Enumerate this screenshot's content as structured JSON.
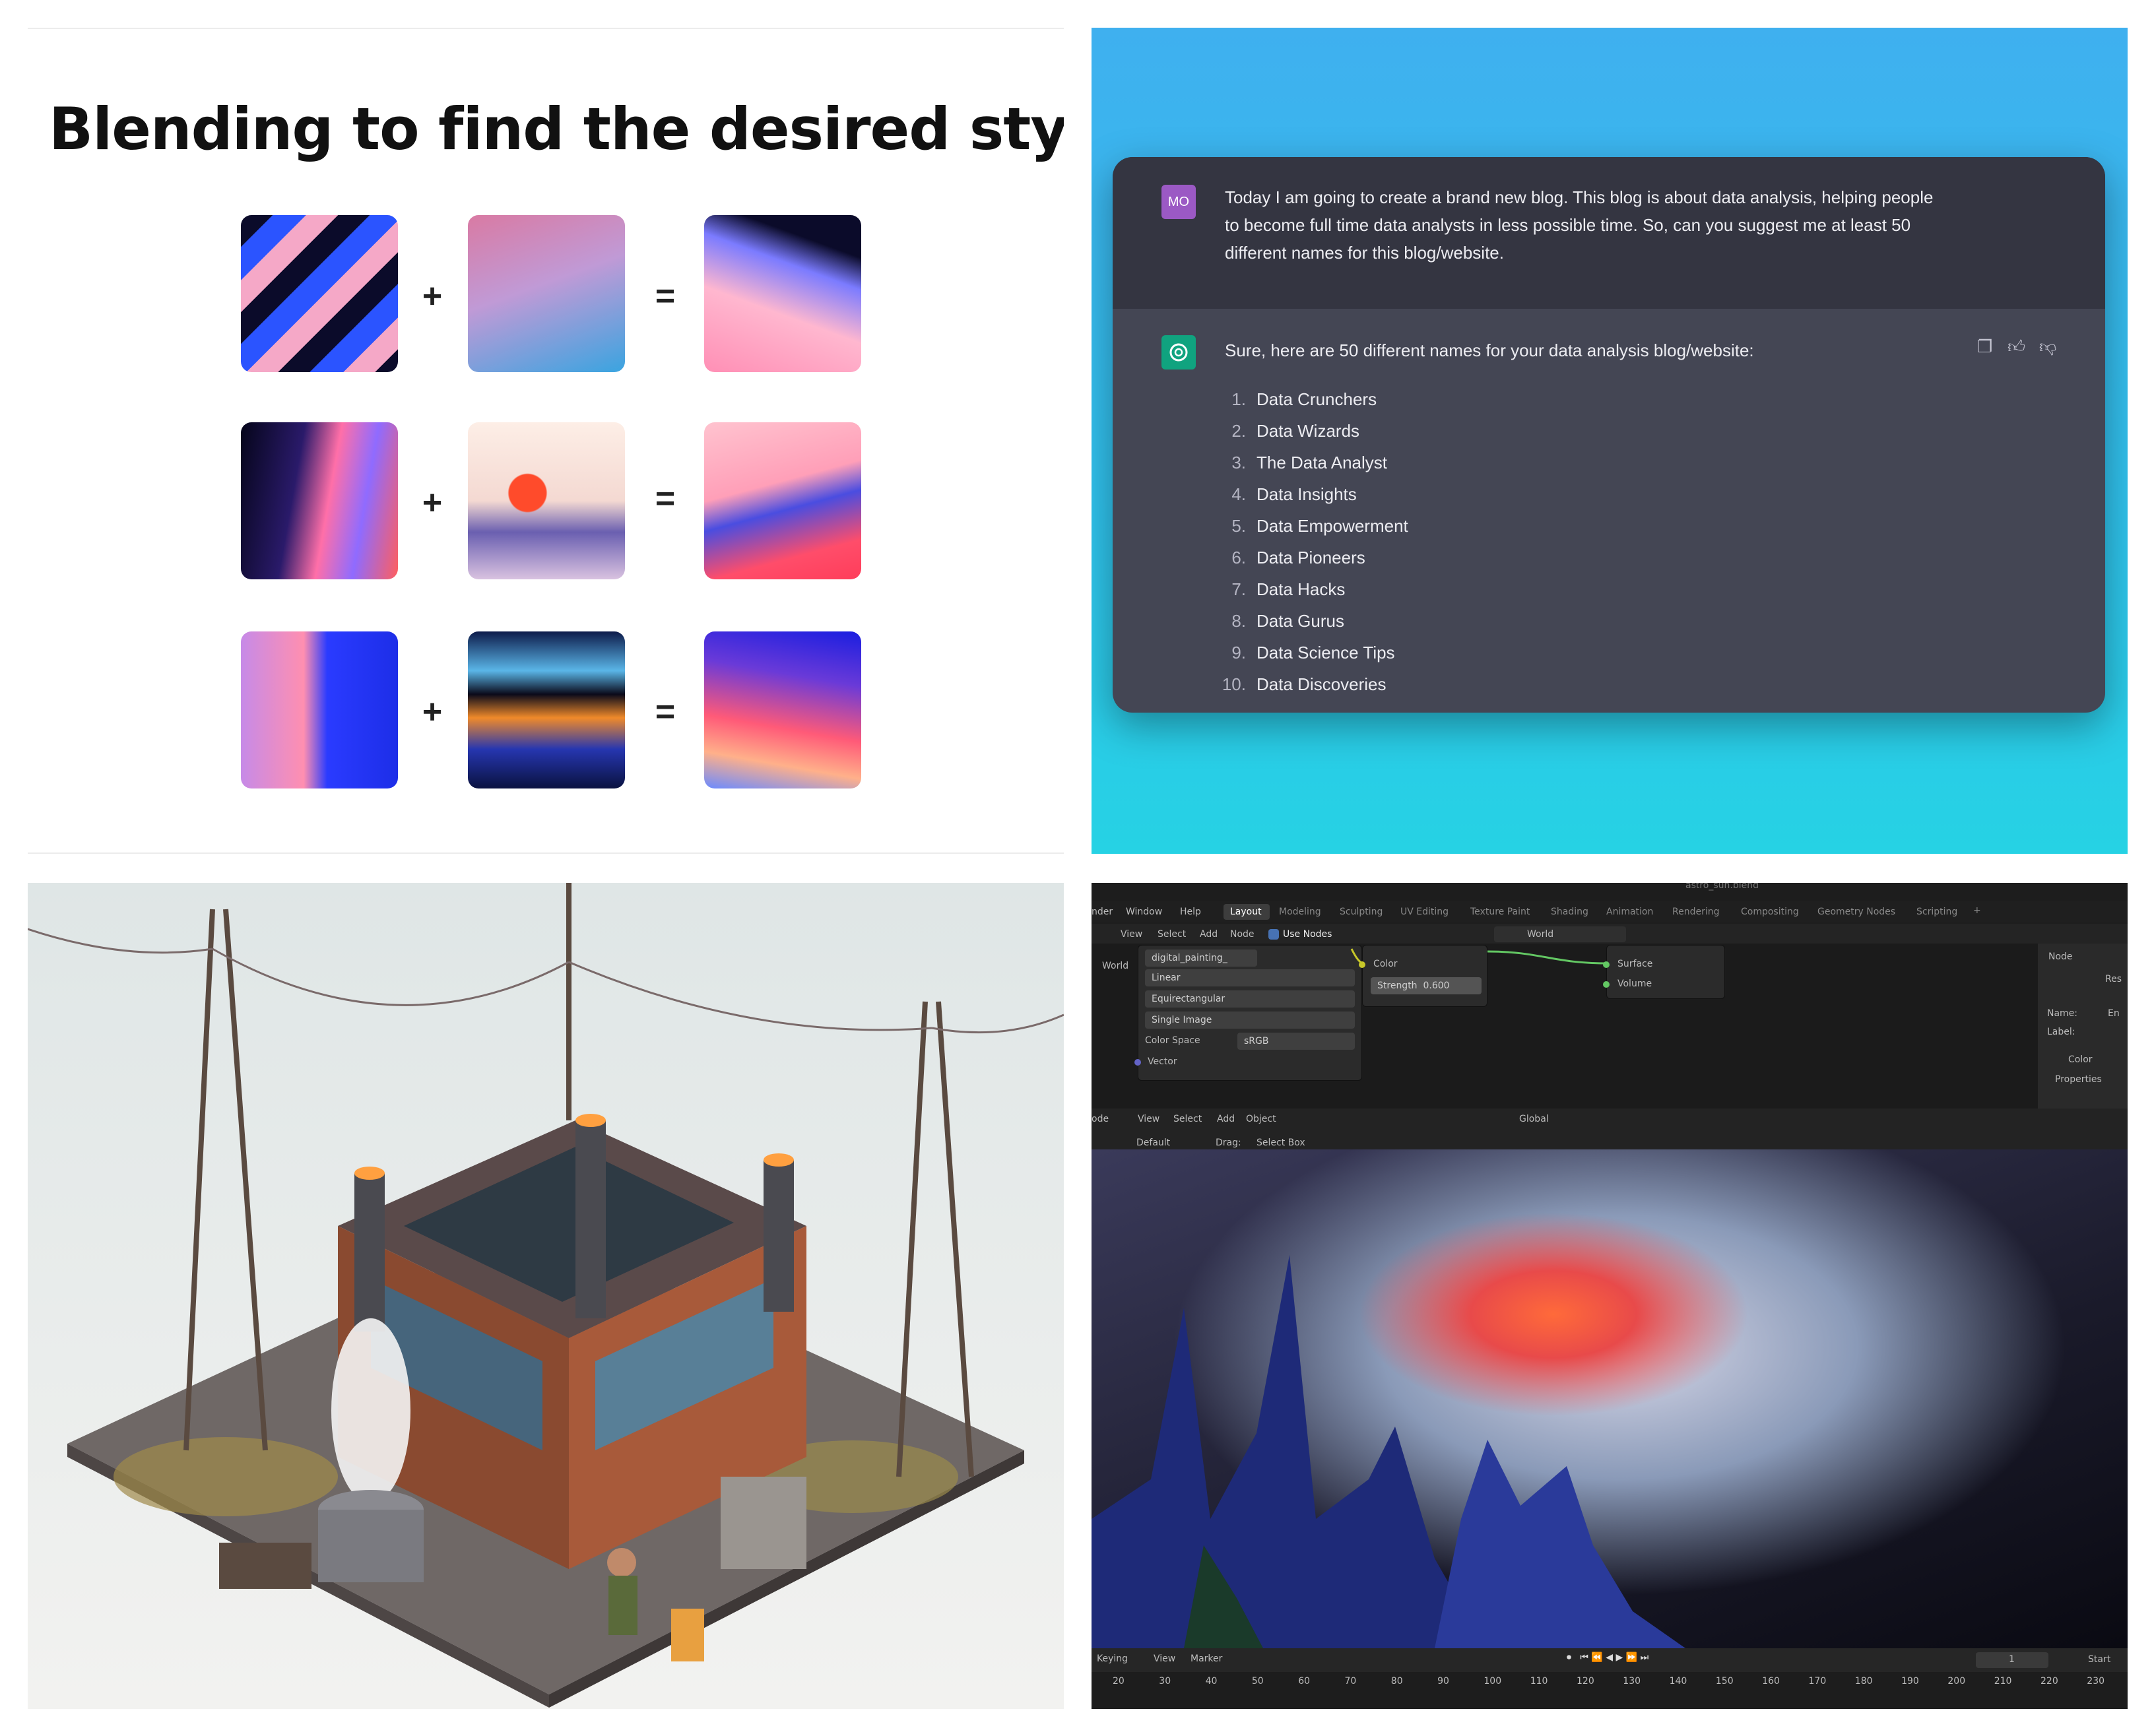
{
  "blending": {
    "headline": "Blending to find the desired style",
    "ops": {
      "plus": "+",
      "equals": "="
    }
  },
  "chat": {
    "user_avatar": "MO",
    "user_message": "Today I am going to create a brand new blog. This blog is about data analysis, helping people to become full time data analysts in less possible time. So, can you suggest me at least 50 different names for this blog/website:",
    "user_lines": [
      "Today I am going to create a brand new blog. This blog is about data analysis, helping people",
      "to become full time data analysts in less possible time. So, can you suggest me at least 50",
      "different names for this blog/website."
    ],
    "assistant_intro": "Sure, here are 50 different names for your data analysis blog/website:",
    "items": [
      {
        "n": "1.",
        "t": "Data Crunchers"
      },
      {
        "n": "2.",
        "t": "Data Wizards"
      },
      {
        "n": "3.",
        "t": "The Data Analyst"
      },
      {
        "n": "4.",
        "t": "Data Insights"
      },
      {
        "n": "5.",
        "t": "Data Empowerment"
      },
      {
        "n": "6.",
        "t": "Data Pioneers"
      },
      {
        "n": "7.",
        "t": "Data Hacks"
      },
      {
        "n": "8.",
        "t": "Data Gurus"
      },
      {
        "n": "9.",
        "t": "Data Science Tips"
      },
      {
        "n": "10.",
        "t": "Data Discoveries"
      }
    ],
    "icons": [
      "copy-icon",
      "thumbs-up-icon",
      "thumbs-down-icon"
    ]
  },
  "blender": {
    "file_title": "astro_sun.blend",
    "menu": [
      "nder",
      "Window",
      "Help"
    ],
    "workspaces": [
      "Layout",
      "Modeling",
      "Sculpting",
      "UV Editing",
      "Texture Paint",
      "Shading",
      "Animation",
      "Rendering",
      "Compositing",
      "Geometry Nodes",
      "Scripting",
      "+"
    ],
    "node_header": [
      "View",
      "Select",
      "Add",
      "Node"
    ],
    "use_nodes": "Use Nodes",
    "world_label": "World",
    "world_field": "World",
    "image_node": {
      "image_name": "digital_painting_",
      "rows": [
        "Linear",
        "Equirectangular",
        "Single Image"
      ],
      "color_space_label": "Color Space",
      "color_space_value": "sRGB",
      "vector": "Vector"
    },
    "background_node": {
      "color": "Color",
      "strength": "Strength",
      "strength_value": "0.600"
    },
    "output_node": {
      "surface": "Surface",
      "volume": "Volume"
    },
    "side_panel": {
      "tab": "Node",
      "reset": "Res",
      "name_label": "Name:",
      "name_value": "En",
      "label_label": "Label:",
      "color": "Color",
      "properties": "Properties"
    },
    "viewport_header": [
      "ode",
      "View",
      "Select",
      "Add",
      "Object"
    ],
    "transform": "Global",
    "orientation_default": "Default",
    "drag_label": "Drag:",
    "drag_value": "Select Box",
    "timeline_menu": [
      "Keying",
      "View",
      "Marker"
    ],
    "frame_current": "1",
    "start_label": "Start",
    "frame_ticks": [
      "20",
      "30",
      "40",
      "50",
      "60",
      "70",
      "80",
      "90",
      "100",
      "110",
      "120",
      "130",
      "140",
      "150",
      "160",
      "170",
      "180",
      "190",
      "200",
      "210",
      "220",
      "230"
    ]
  }
}
